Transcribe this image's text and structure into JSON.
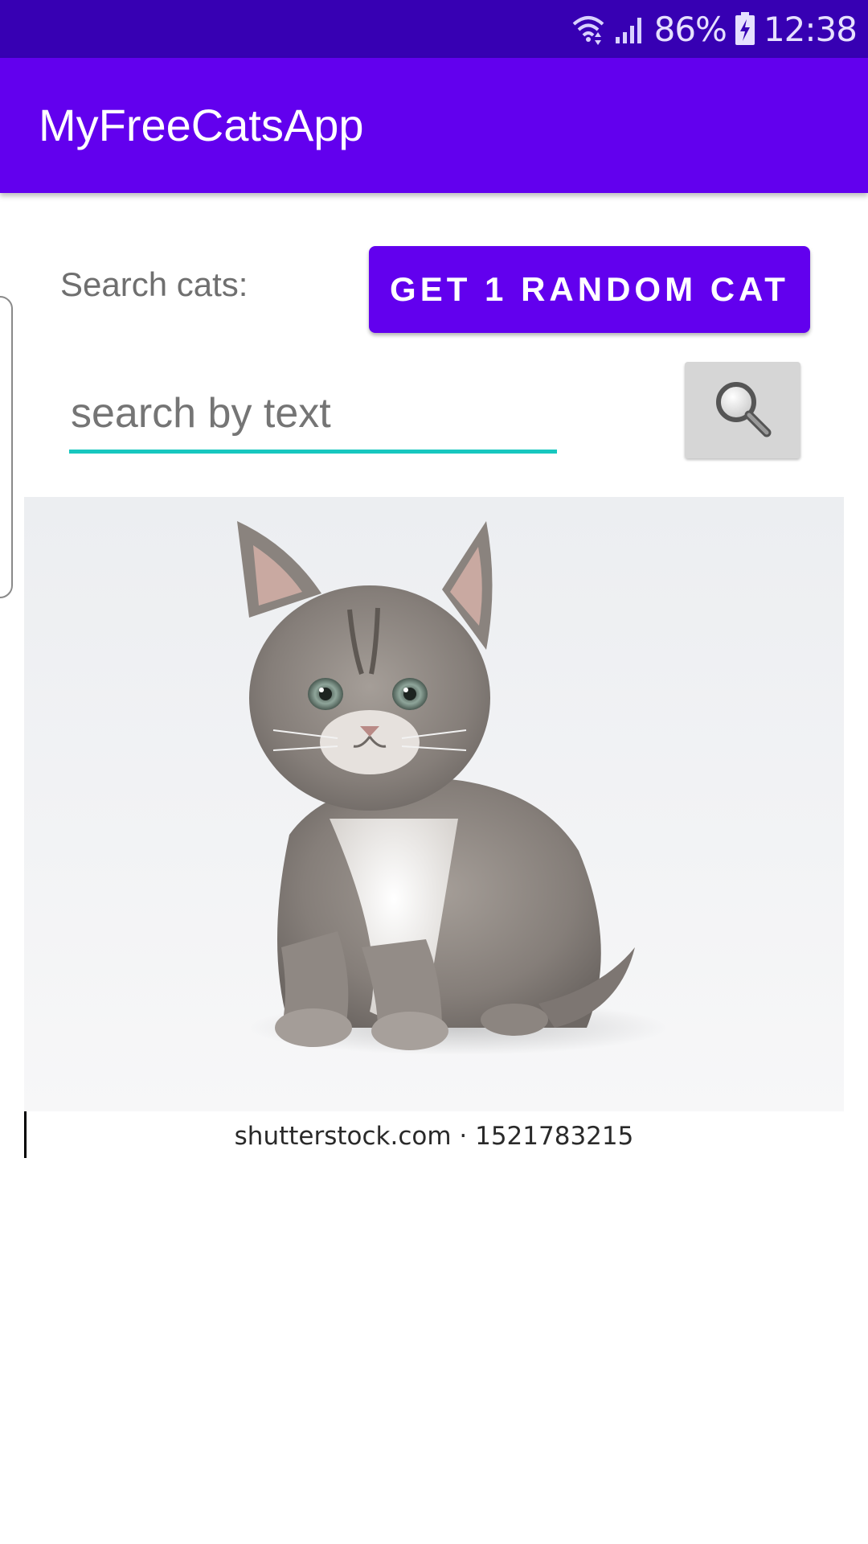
{
  "status_bar": {
    "battery": "86%",
    "time": "12:38",
    "icons": [
      "wifi-icon",
      "signal-icon",
      "battery-charging-icon"
    ]
  },
  "app_bar": {
    "title": "MyFreeCatsApp",
    "color": "#6200ee"
  },
  "search": {
    "label": "Search cats:",
    "random_button_label": "GET 1 RANDOM CAT",
    "input_placeholder": "search by text",
    "input_value": "",
    "search_button_icon": "magnifier-icon",
    "accent": "#18c7bf"
  },
  "result": {
    "image": "kitten-photo",
    "caption": "shutterstock.com · 1521783215"
  }
}
